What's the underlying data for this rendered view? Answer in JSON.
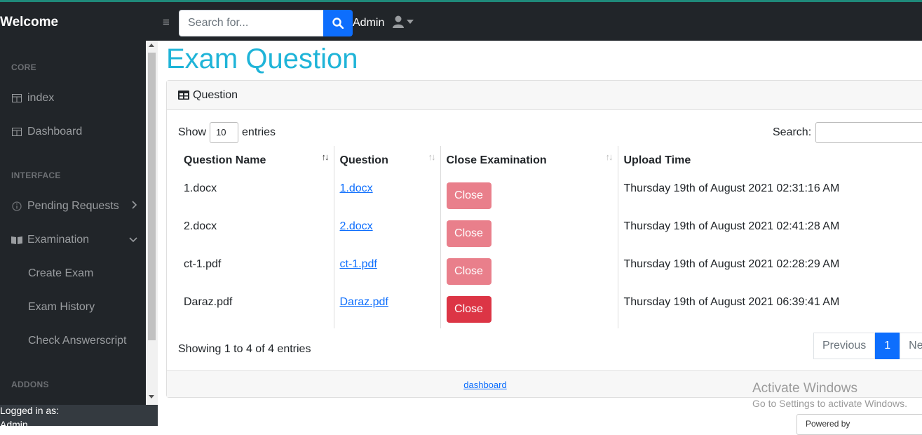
{
  "brand": "Welcome",
  "search": {
    "placeholder": "Search for..."
  },
  "admin_label": "Admin",
  "sidebar": {
    "headings": [
      "CORE",
      "INTERFACE",
      "ADDONS"
    ],
    "items": [
      {
        "label": "index"
      },
      {
        "label": "Dashboard"
      },
      {
        "label": "Pending Requests"
      },
      {
        "label": "Examination"
      }
    ],
    "sub_items": [
      "Create Exam",
      "Exam History",
      "Check Answerscript"
    ],
    "footer_label": "Logged in as:",
    "footer_user": "Admin"
  },
  "page_title": "Exam Question",
  "card": {
    "header": "Question",
    "show_label": "Show",
    "length_value": "10",
    "entries_label": "entries",
    "search_label": "Search:",
    "columns": [
      "Question Name",
      "Question",
      "Close Examination",
      "Upload Time"
    ],
    "rows": [
      {
        "name": "1.docx",
        "link": "1.docx",
        "button": "Close",
        "time": "Thursday 19th of August 2021 02:31:16 AM"
      },
      {
        "name": "2.docx",
        "link": "2.docx",
        "button": "Close",
        "time": "Thursday 19th of August 2021 02:41:28 AM"
      },
      {
        "name": "ct-1.pdf",
        "link": "ct-1.pdf",
        "button": "Close",
        "time": "Thursday 19th of August 2021 02:28:29 AM"
      },
      {
        "name": "Daraz.pdf",
        "link": "Daraz.pdf",
        "button": "Close",
        "time": "Thursday 19th of August 2021 06:39:41 AM"
      }
    ],
    "info": "Showing 1 to 4 of 4 entries",
    "pager": {
      "previous": "Previous",
      "current": "1",
      "next": "Nex"
    },
    "footer_link": "dashboard"
  },
  "watermark": {
    "line1": "Activate Windows",
    "line2": "Go to Settings to activate Windows."
  },
  "powered": "Powered by",
  "colors": {
    "title": "#1fb4d8",
    "primary": "#0d6efd",
    "danger": "#dc3545",
    "sidebar": "#212529"
  }
}
